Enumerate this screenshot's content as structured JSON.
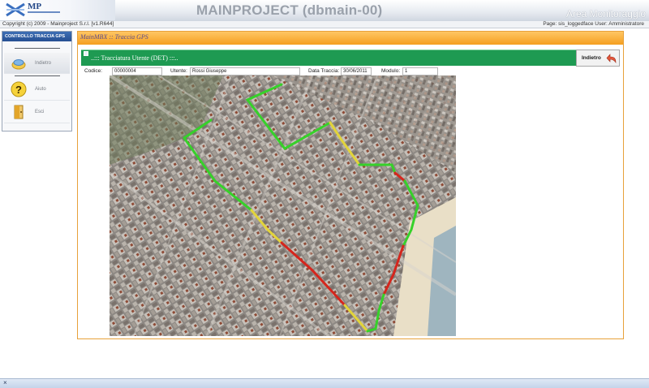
{
  "header": {
    "logo_text": "MP",
    "app_title": "MAINPROJECT (dbmain-00)",
    "area_title": "Area Monitoraggio",
    "copyright": "Copyright (c) 2009 - Mainproject S.r.l. [v1.R644]",
    "user_info": "Page: sis_loggedface  User: Amministratore"
  },
  "sidebar": {
    "title": "CONTROLLO TRACCIA GPS",
    "items": [
      {
        "label": "Indietro",
        "icon": "folder-icon"
      },
      {
        "label": "Aiuto",
        "icon": "help-icon"
      },
      {
        "label": "Esci",
        "icon": "exit-door-icon"
      }
    ]
  },
  "main": {
    "title": "MainMBX :: Traccia GPS",
    "detail_title": "..::: Tracciatura Utente (DET) :::..",
    "back_label": "Indietro",
    "fields": {
      "codice_label": "Codice:",
      "codice_value": "00000004",
      "utente_label": "Utente:",
      "utente_value": "Rossi Giuseppe",
      "data_label": "Data Traccia:",
      "data_value": "30/06/2011",
      "modulo_label": "Modulo:",
      "modulo_value": "1"
    }
  },
  "map": {
    "track_colors": {
      "good": "#36d12a",
      "medium": "#e2d43a",
      "bad": "#d5261d"
    }
  },
  "status": {
    "close": "×"
  }
}
